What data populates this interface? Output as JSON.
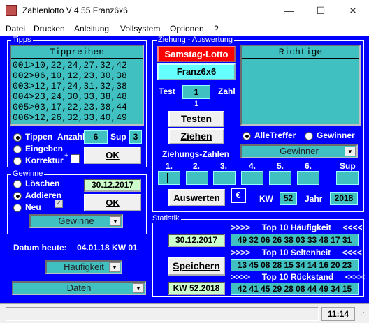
{
  "window": {
    "title": "Zahlenlotto V 4.55  Franz6x6",
    "minimize": "—",
    "maximize": "☐",
    "close": "✕"
  },
  "menu": [
    "Datei",
    "Drucken",
    "Anleitung",
    "Vollsystem",
    "Optionen",
    "?"
  ],
  "tipps": {
    "group_label": "Tipps",
    "header": "Tippreihen",
    "rows": [
      "001>10,22,24,27,32,42",
      "002>06,10,12,23,30,38",
      "003>12,17,24,31,32,38",
      "004>23,24,30,33,38,48",
      "005>03,17,22,23,38,44",
      "006>12,26,32,33,40,49"
    ],
    "radio_tippen": "Tippen",
    "anzahl_label": "Anzahl",
    "anzahl_value": "6",
    "sup_label": "Sup",
    "sup_value": "3",
    "radio_eingeben": "Eingeben",
    "radio_korrektur": "Korrektur",
    "plus": "+",
    "ok": "OK"
  },
  "gewinne": {
    "group_label": "Gewinne",
    "radio_loeschen": "Löschen",
    "radio_addieren": "Addieren",
    "radio_neu": "Neu",
    "date": "30.12.2017",
    "ok": "OK",
    "combo": "Gewinne"
  },
  "datum": {
    "label": "Datum heute:",
    "value": "04.01.18 KW 01"
  },
  "combo_haeufigkeit": "Häufigkeit",
  "combo_daten": "Daten",
  "ziehung": {
    "group_label": "Ziehung - Auswertung",
    "lotto_button": "Samstag-Lotto",
    "game_button": "Franz6x6",
    "test_label": "Test",
    "test_value": "1",
    "zahl_label": "Zahl",
    "small_num": "1",
    "testen": "Testen",
    "ziehen": "Ziehen",
    "richtige_header": "Richtige",
    "radio_alletreffer": "AlleTreffer",
    "radio_gewinner": "Gewinner",
    "combo_gewinner": "Gewinner",
    "zahlen_label": "Ziehungs-Zahlen",
    "columns": [
      "1.",
      "2.",
      "3.",
      "4.",
      "5.",
      "6.",
      "Sup"
    ],
    "auswerten": "Auswerten",
    "euro": "€",
    "kw_label": "KW",
    "kw_value": "52",
    "jahr_label": "Jahr",
    "jahr_value": "2018"
  },
  "statistik": {
    "group_label": "Statistik",
    "top_haeufigkeit": ">>>>     Top 10 Häufigkeit     <<<<",
    "top_seltenheit": ">>>>     Top 10 Seltenheit     <<<<",
    "top_rueckstand": ">>>>     Top 10 Rückstand     <<<<",
    "date": "30.12.2017",
    "speichern": "Speichern",
    "kw": "KW 52.2018",
    "row_haeufigkeit": "49 32 06 26 38 03 33 48 17 31",
    "row_seltenheit": "13 45 08 28 15 34 14 16 20 23",
    "row_rueckstand": "42 41 45 29 28 08 44 49 34 15"
  },
  "status": {
    "time": "11:14"
  },
  "colors": {
    "background": "#0000ff",
    "panel": "#40c0c0",
    "lotto_button": "#ff0000",
    "game_button": "#66ffff",
    "date_field": "#ccffcc"
  }
}
